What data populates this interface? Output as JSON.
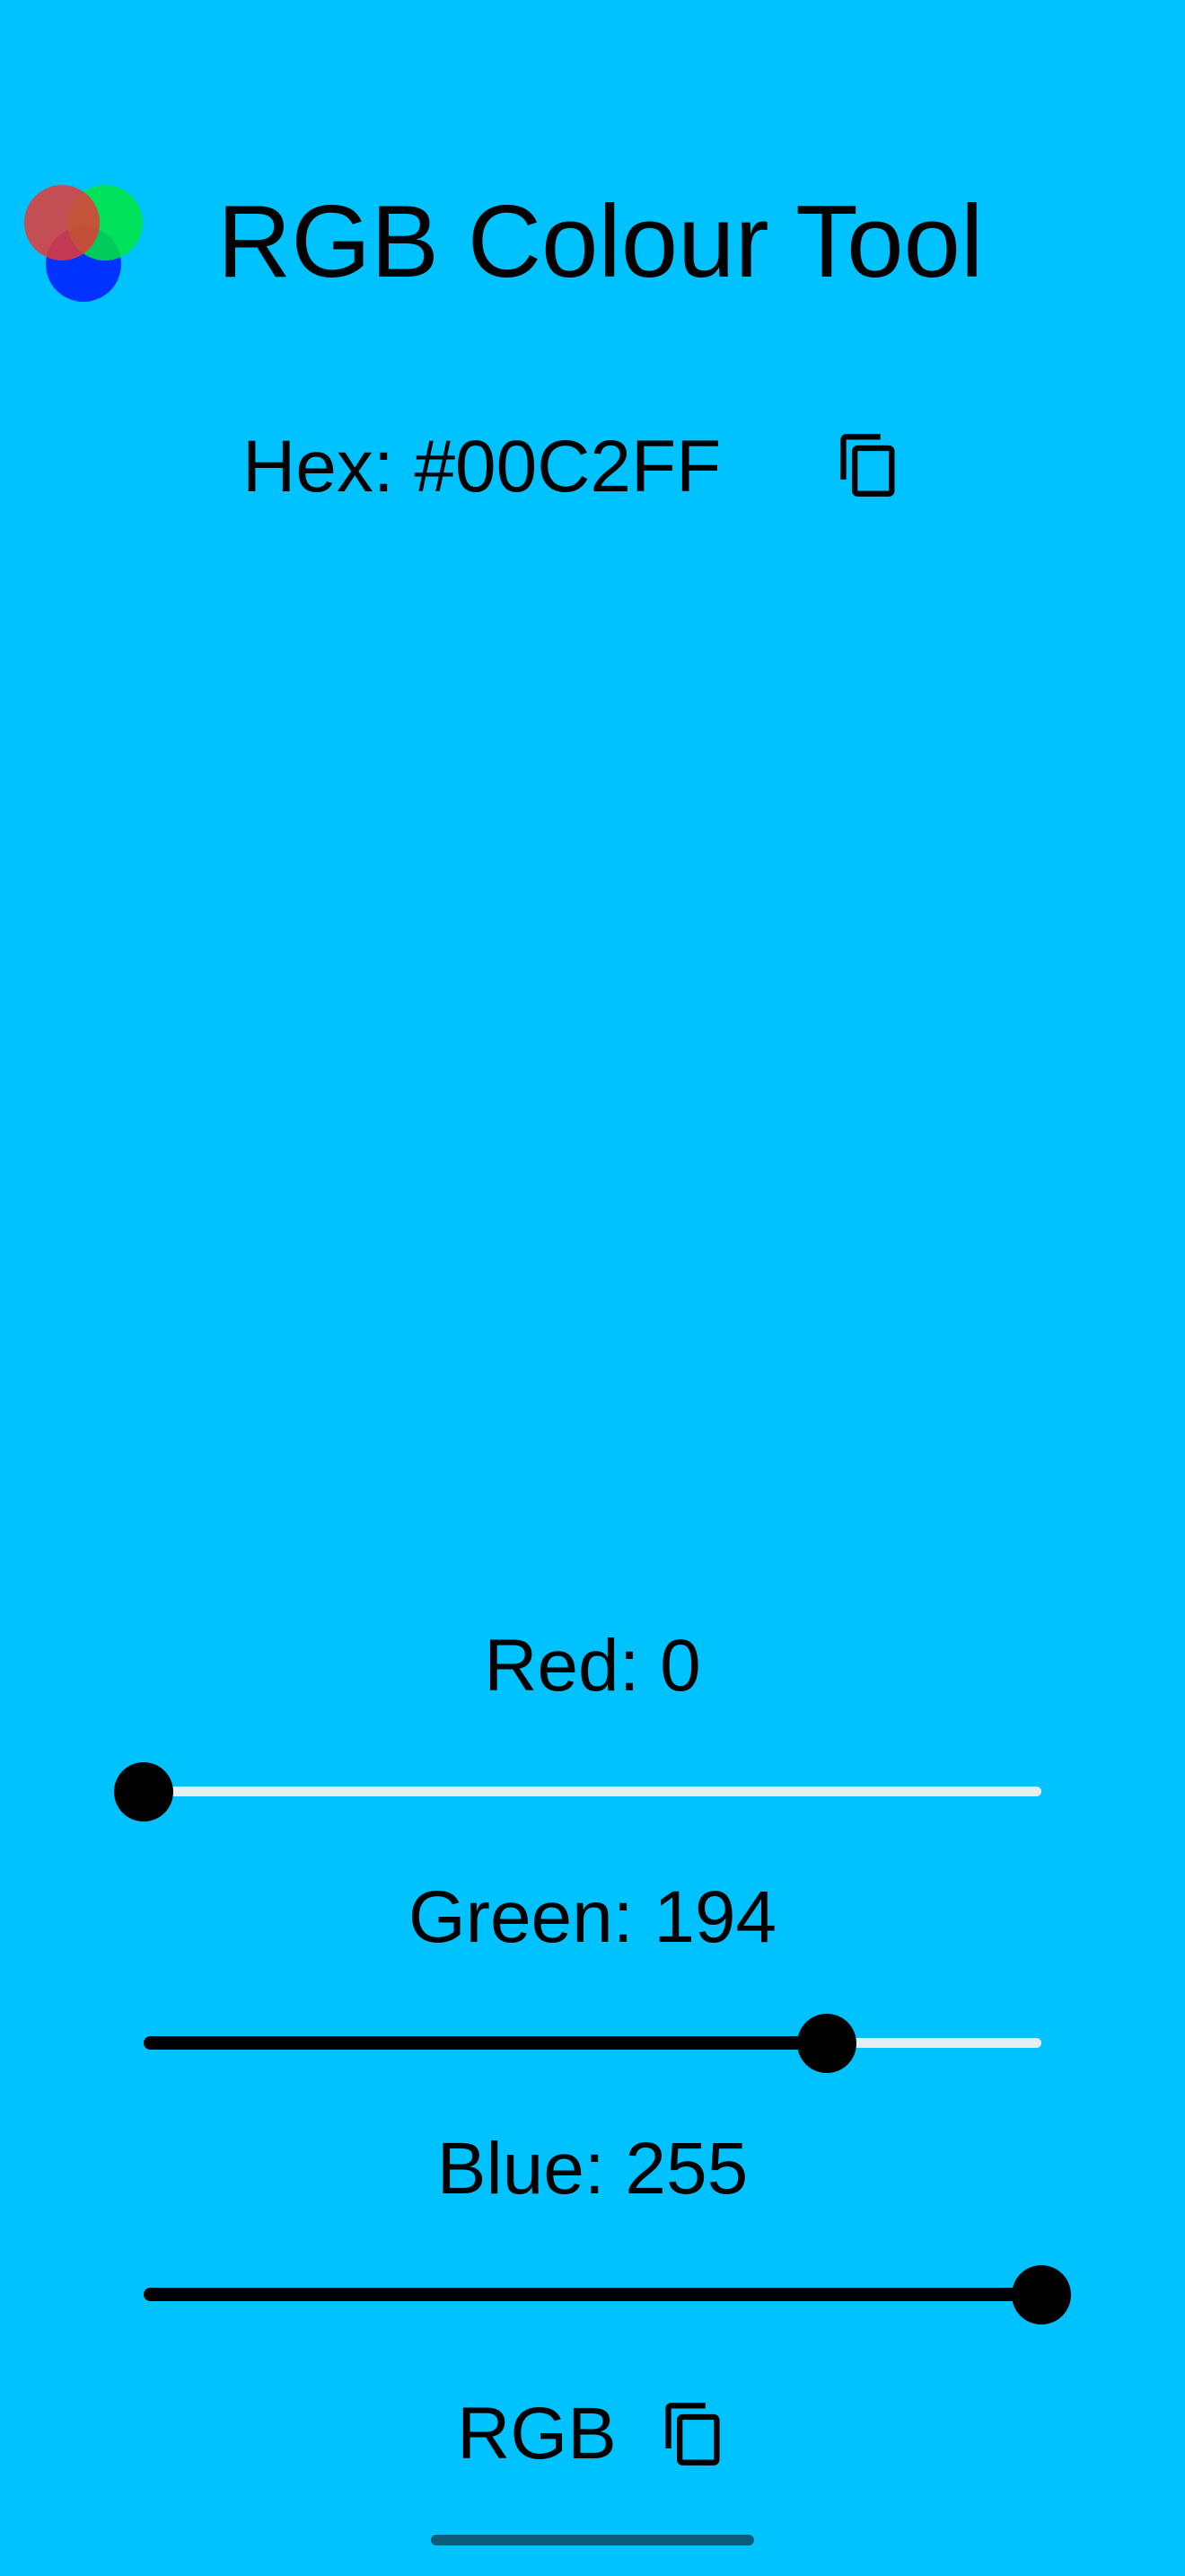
{
  "app": {
    "title": "RGB Colour Tool",
    "background_color": "#00C2FF",
    "logo_icon": "overlapping-rgb-circles-icon"
  },
  "hex": {
    "label": "Hex: #00C2FF",
    "copy_icon": "copy-icon"
  },
  "channels": [
    {
      "name": "Red",
      "label": "Red: 0",
      "value": 0,
      "max": 255
    },
    {
      "name": "Green",
      "label": "Green: 194",
      "value": 194,
      "max": 255
    },
    {
      "name": "Blue",
      "label": "Blue: 255",
      "value": 255,
      "max": 255
    }
  ],
  "rgb_copy": {
    "label": "RGB",
    "copy_icon": "copy-icon"
  },
  "colors": {
    "logo_red": "#E53935",
    "logo_green": "#00E640",
    "logo_blue": "#0033FF",
    "slider_active": "#000000",
    "slider_inactive": "#E6EEF2"
  }
}
